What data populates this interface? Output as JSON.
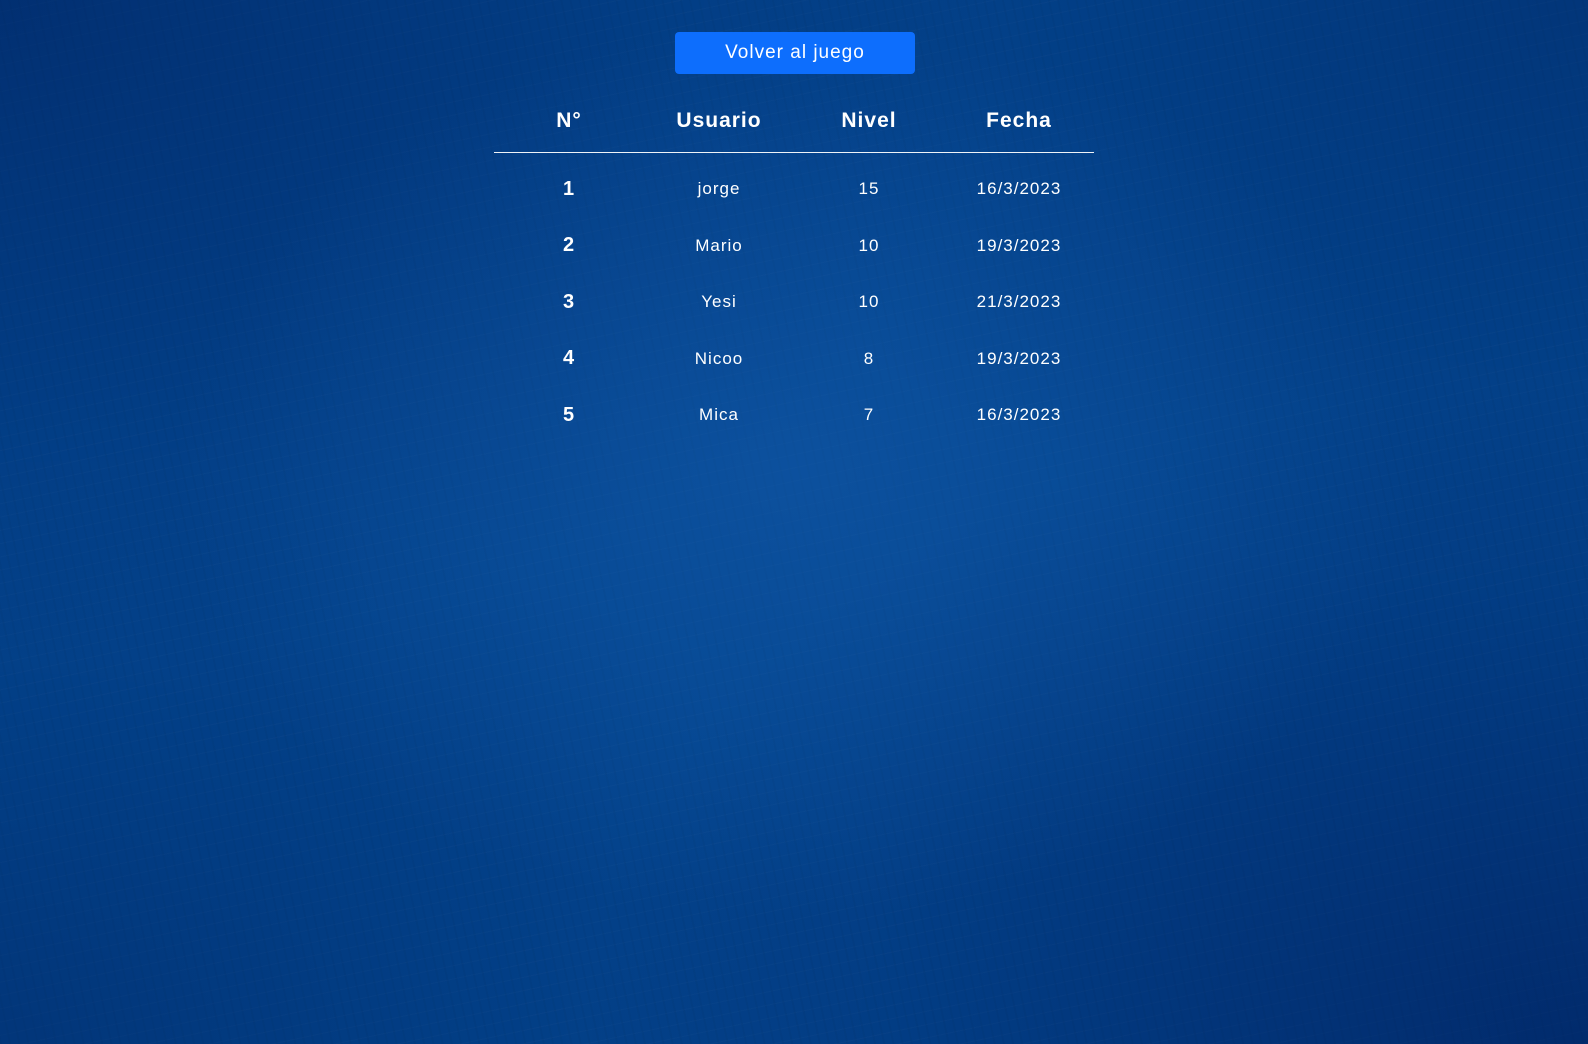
{
  "back_button": {
    "label": "Volver al juego"
  },
  "table": {
    "headers": {
      "rank": "N°",
      "user": "Usuario",
      "level": "Nivel",
      "date": "Fecha"
    },
    "rows": [
      {
        "rank": "1",
        "user": "jorge",
        "level": "15",
        "date": "16/3/2023"
      },
      {
        "rank": "2",
        "user": "Mario",
        "level": "10",
        "date": "19/3/2023"
      },
      {
        "rank": "3",
        "user": "Yesi",
        "level": "10",
        "date": "21/3/2023"
      },
      {
        "rank": "4",
        "user": "Nicoo",
        "level": "8",
        "date": "19/3/2023"
      },
      {
        "rank": "5",
        "user": "Mica",
        "level": "7",
        "date": "16/3/2023"
      }
    ]
  },
  "colors": {
    "background": "#03458f",
    "button": "#0d6efd",
    "text": "#ffffff"
  }
}
